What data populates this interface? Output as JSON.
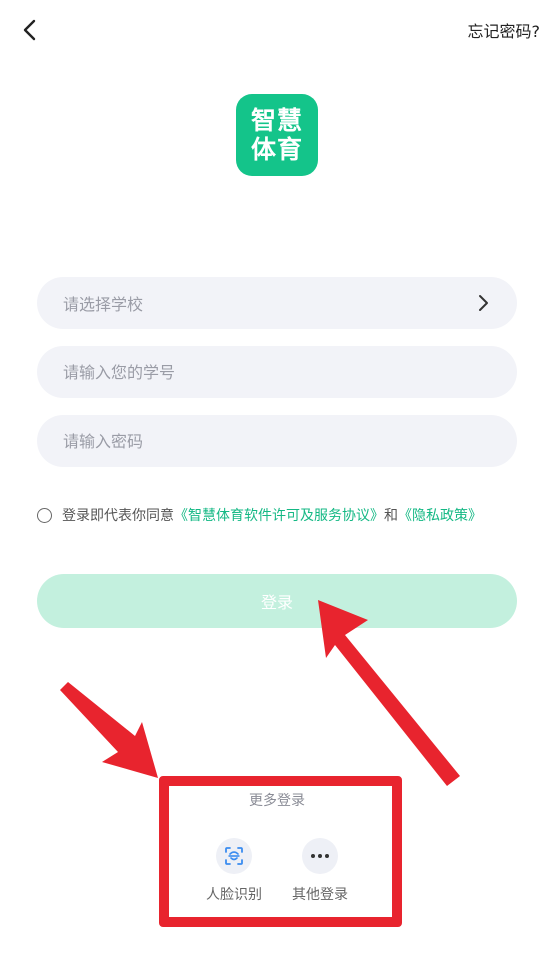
{
  "header": {
    "forgot_password": "忘记密码?"
  },
  "logo": {
    "line1": "智慧",
    "line2": "体育",
    "color": "#14c48a"
  },
  "form": {
    "school_placeholder": "请选择学校",
    "student_id_placeholder": "请输入您的学号",
    "password_placeholder": "请输入密码"
  },
  "agreement": {
    "prefix": "登录即代表你同意",
    "terms_link": "《智慧体育软件许可及服务协议》",
    "and": "和",
    "privacy_link": "《隐私政策》",
    "link_color": "#14b884"
  },
  "login_button": {
    "label": "登录",
    "color": "#c3f0de"
  },
  "more_login": {
    "title": "更多登录",
    "options": [
      {
        "label": "人脸识别",
        "icon": "face-recognition-icon"
      },
      {
        "label": "其他登录",
        "icon": "more-dots-icon"
      }
    ]
  },
  "annotation": {
    "color": "#e8242e"
  }
}
